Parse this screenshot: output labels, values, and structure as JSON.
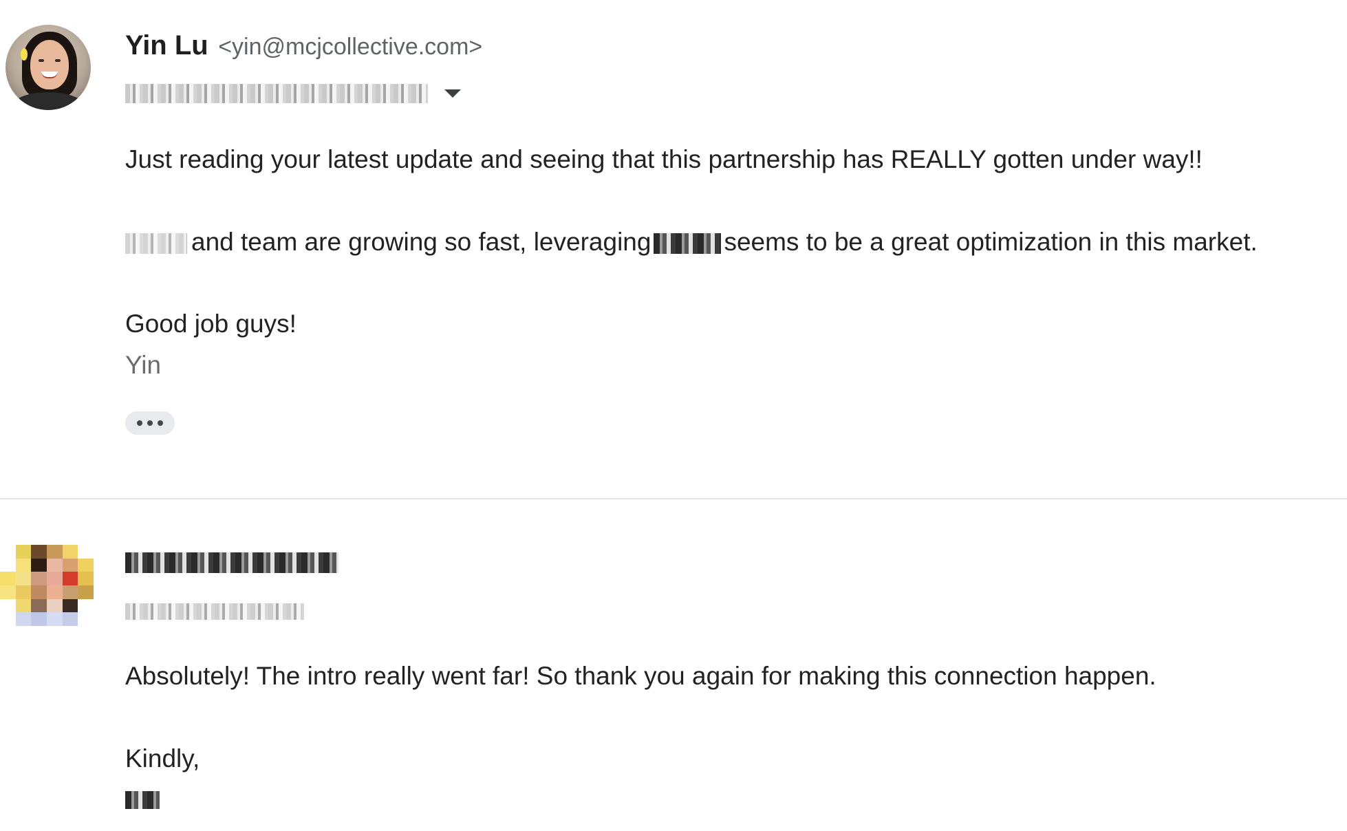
{
  "messages": [
    {
      "sender_name": "Yin Lu",
      "sender_email": "<yin@mcjcollective.com>",
      "avatar": "person-photo",
      "show_details_icon": "chevron-down-icon",
      "paragraphs": [
        "Just reading your latest update and seeing that this partnership has REALLY gotten under way!!",
        "and team are growing so fast, leveraging",
        "seems to be a great optimization in this market.",
        "Good job guys!"
      ],
      "signature": "Yin",
      "more_icon": "more-horizontal-icon"
    },
    {
      "avatar": "pixelated-avatar",
      "paragraphs": [
        "Absolutely! The intro really went far! So thank you again for making this connection happen.",
        "Kindly,"
      ]
    }
  ],
  "colors": {
    "text": "#222222",
    "secondary_text": "#5f6368",
    "signature_text": "#6b6b6b",
    "divider": "#e6e6e6",
    "pill_background": "#e8eaed"
  }
}
